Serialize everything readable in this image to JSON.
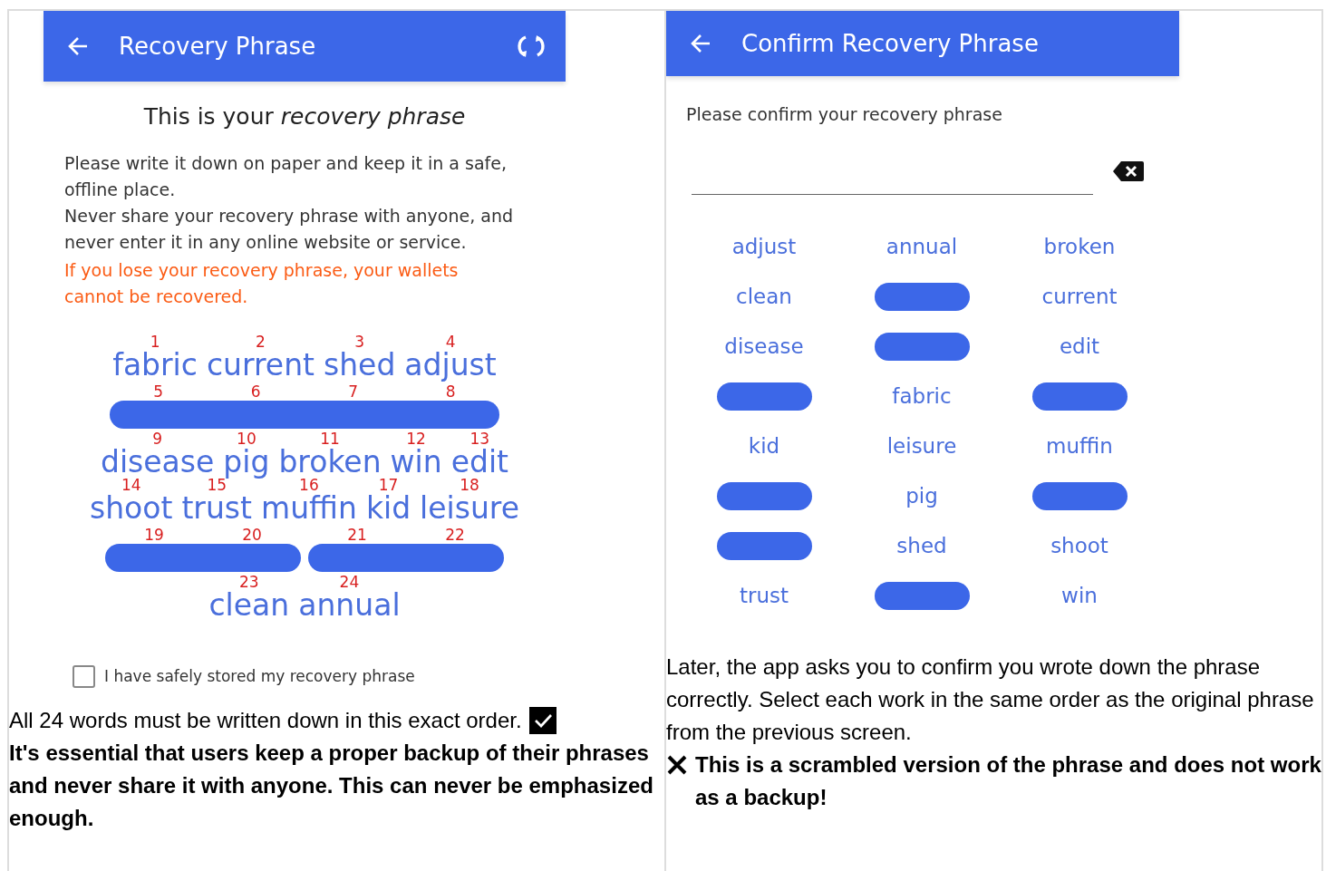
{
  "left_screen": {
    "header": {
      "title": "Recovery Phrase"
    },
    "heading": "This is your *recovery phrase*",
    "paragraphs": [
      "Please write it down on paper and keep it in a safe, offline place.",
      "Never share your recovery phrase with anyone, and never enter it in any online website or service."
    ],
    "warning": "If you lose your recovery phrase, your wallets cannot be recovered.",
    "phrase_rows": [
      {
        "kind": "words",
        "items": [
          {
            "number": "1",
            "word": "fabric"
          },
          {
            "number": "2",
            "word": "current"
          },
          {
            "number": "3",
            "word": "shed"
          },
          {
            "number": "4",
            "word": "adjust"
          }
        ]
      },
      {
        "kind": "redacted",
        "bars": [
          {
            "numbers": [
              "5",
              "6",
              "7",
              "8"
            ]
          }
        ]
      },
      {
        "kind": "words",
        "items": [
          {
            "number": "9",
            "word": "disease"
          },
          {
            "number": "10",
            "word": "pig"
          },
          {
            "number": "11",
            "word": "broken"
          },
          {
            "number": "12",
            "word": "win"
          },
          {
            "number": "13",
            "word": "edit"
          }
        ]
      },
      {
        "kind": "words",
        "items": [
          {
            "number": "14",
            "word": "shoot"
          },
          {
            "number": "15",
            "word": "trust"
          },
          {
            "number": "16",
            "word": "muffin"
          },
          {
            "number": "17",
            "word": "kid"
          },
          {
            "number": "18",
            "word": "leisure"
          }
        ]
      },
      {
        "kind": "redacted",
        "bars": [
          {
            "numbers": [
              "19",
              "20"
            ]
          },
          {
            "numbers": [
              "21",
              "22"
            ]
          }
        ]
      },
      {
        "kind": "words",
        "items": [
          {
            "number": "23",
            "word": "clean"
          },
          {
            "number": "24",
            "word": "annual"
          }
        ]
      }
    ],
    "checkbox": {
      "label": "I have safely stored my recovery phrase",
      "checked": false
    }
  },
  "left_caption": {
    "text": "All 24 words must be written down in this exact order.",
    "note": "It's essential that users keep a proper backup of their phrases and never share it with anyone. This can never be emphasized enough."
  },
  "right_screen": {
    "header": {
      "title": "Confirm Recovery Phrase"
    },
    "prompt": "Please confirm your recovery phrase",
    "word_grid": [
      {
        "kind": "word",
        "word": "adjust"
      },
      {
        "kind": "word",
        "word": "annual"
      },
      {
        "kind": "word",
        "word": "broken"
      },
      {
        "kind": "word",
        "word": "clean"
      },
      {
        "kind": "redacted"
      },
      {
        "kind": "word",
        "word": "current"
      },
      {
        "kind": "word",
        "word": "disease"
      },
      {
        "kind": "redacted"
      },
      {
        "kind": "word",
        "word": "edit"
      },
      {
        "kind": "redacted"
      },
      {
        "kind": "word",
        "word": "fabric"
      },
      {
        "kind": "redacted"
      },
      {
        "kind": "word",
        "word": "kid"
      },
      {
        "kind": "word",
        "word": "leisure"
      },
      {
        "kind": "word",
        "word": "muffin"
      },
      {
        "kind": "redacted"
      },
      {
        "kind": "word",
        "word": "pig"
      },
      {
        "kind": "redacted"
      },
      {
        "kind": "redacted"
      },
      {
        "kind": "word",
        "word": "shed"
      },
      {
        "kind": "word",
        "word": "shoot"
      },
      {
        "kind": "word",
        "word": "trust"
      },
      {
        "kind": "redacted"
      },
      {
        "kind": "word",
        "word": "win"
      }
    ]
  },
  "right_caption": {
    "text": "Later, the app asks you to confirm you wrote down the phrase correctly. Select each work in the same order as the original phrase from the previous screen.",
    "note": "This is a scrambled version of the phrase and does not work as a backup!"
  }
}
